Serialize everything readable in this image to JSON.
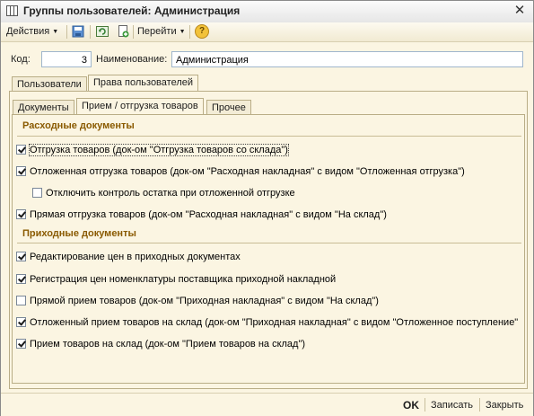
{
  "window": {
    "title": "Группы пользователей: Администрация",
    "close_symbol": "✕"
  },
  "toolbar": {
    "actions_label": "Действия",
    "goto_label": "Перейти",
    "icons": [
      "save-icon",
      "refresh-icon",
      "copy-icon",
      "help-icon"
    ],
    "help_symbol": "?"
  },
  "form": {
    "code_label": "Код:",
    "code_value": "3",
    "name_label": "Наименование:",
    "name_value": "Администрация"
  },
  "tabs": [
    {
      "label": "Пользователи",
      "active": false
    },
    {
      "label": "Права пользователей",
      "active": true
    }
  ],
  "subtabs": [
    {
      "label": "Документы",
      "active": false
    },
    {
      "label": "Прием / отгрузка товаров",
      "active": true
    },
    {
      "label": "Прочее",
      "active": false
    }
  ],
  "sections": {
    "expense_title": "Расходные документы",
    "income_title": "Приходные документы"
  },
  "expense_items": [
    {
      "label": "Отгрузка товаров (док-ом \"Отгрузка товаров со склада\")",
      "checked": true
    },
    {
      "label": "Отложенная отгрузка товаров (док-ом \"Расходная накладная\" с видом \"Отложенная отгрузка\")",
      "checked": true
    },
    {
      "label": "Отключить контроль остатка при отложенной отгрузке",
      "checked": false
    },
    {
      "label": "Прямая отгрузка товаров (док-ом \"Расходная накладная\" с видом \"На склад\")",
      "checked": true
    }
  ],
  "income_items": [
    {
      "label": "Редактирование цен в приходных документах",
      "checked": true
    },
    {
      "label": "Регистрация цен номенклатуры поставщика приходной накладной",
      "checked": true
    },
    {
      "label": "Прямой прием товаров (док-ом \"Приходная накладная\" с видом \"На склад\")",
      "checked": false
    },
    {
      "label": "Отложенный прием товаров на склад (док-ом \"Приходная накладная\" с видом \"Отложенное поступление\"",
      "checked": true
    },
    {
      "label": "Прием товаров на склад (док-ом \"Прием товаров на склад\")",
      "checked": true
    }
  ],
  "buttons": {
    "ok": "OK",
    "save": "Записать",
    "close": "Закрыть"
  },
  "colors": {
    "background": "#fbf5e2",
    "section_title": "#8a5a00",
    "field_border": "#9fb6cc"
  }
}
